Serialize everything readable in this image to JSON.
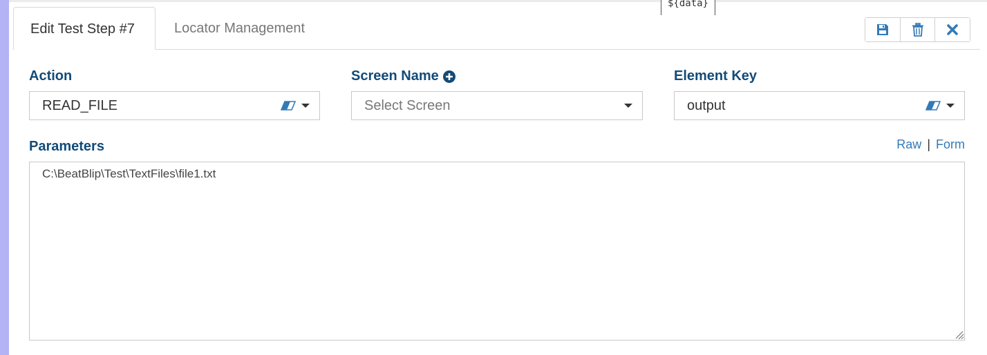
{
  "tooltip": {
    "text": "${data}"
  },
  "tabs": [
    {
      "label": "Edit Test Step #7",
      "active": true
    },
    {
      "label": "Locator Management",
      "active": false
    }
  ],
  "toolbar": {
    "icons": [
      "save-icon",
      "trash-icon",
      "close-icon"
    ],
    "accent_color": "#337ab7"
  },
  "form": {
    "action": {
      "label": "Action",
      "value": "READ_FILE"
    },
    "screen_name": {
      "label": "Screen Name",
      "placeholder": "Select Screen"
    },
    "element_key": {
      "label": "Element Key",
      "value": "output"
    },
    "parameters": {
      "label": "Parameters",
      "value": "C:\\BeatBlip\\Test\\TextFiles\\file1.txt",
      "mode_raw": "Raw",
      "mode_separator": "|",
      "mode_form": "Form"
    }
  },
  "colors": {
    "label": "#124b78",
    "link": "#337ab7",
    "left_bar": "#b3b3f5"
  }
}
